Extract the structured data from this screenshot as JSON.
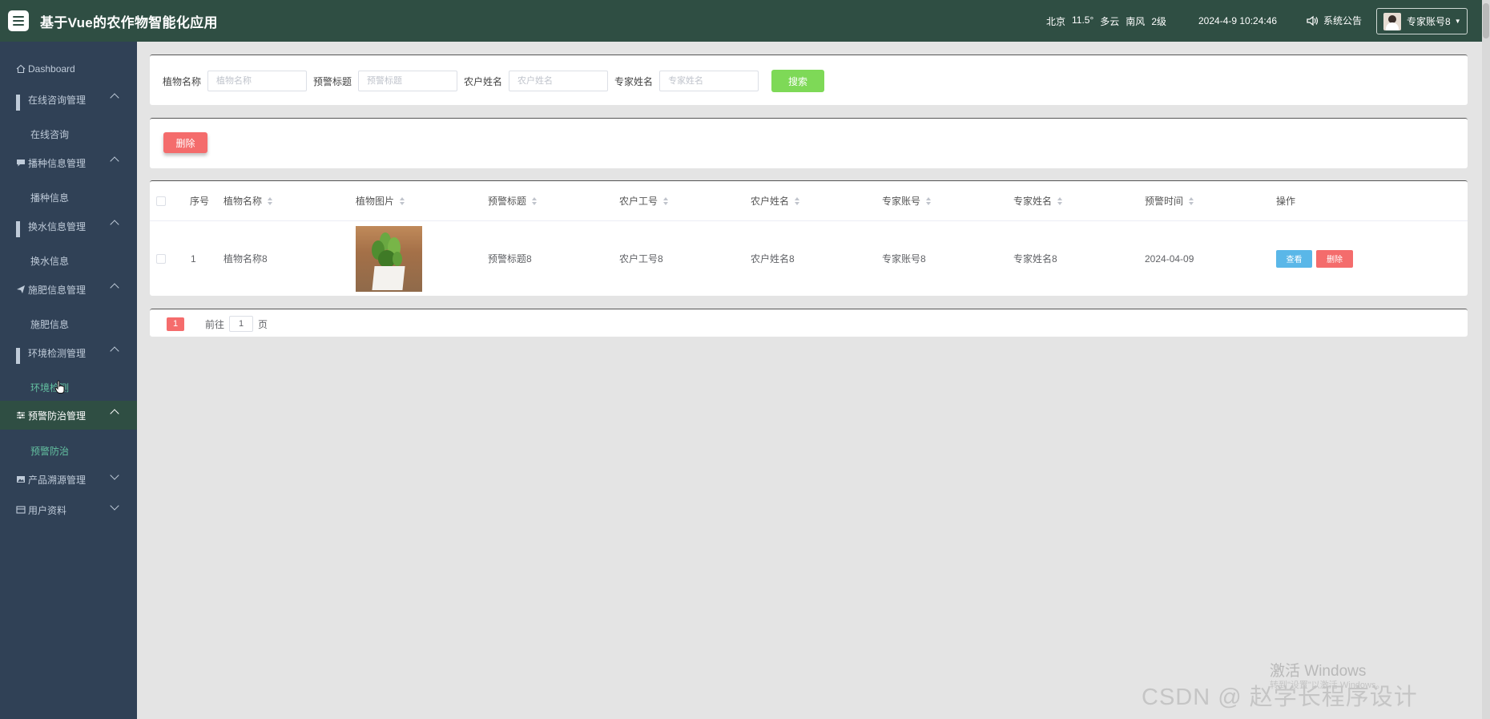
{
  "header": {
    "title": "基于Vue的农作物智能化应用",
    "weather": {
      "city": "北京",
      "temperature": "11.5°",
      "condition": "多云",
      "wind_dir": "南风",
      "wind_level": "2级"
    },
    "datetime": "2024-4-9 10:24:46",
    "notice": "系统公告",
    "user": "专家账号8"
  },
  "sidebar": {
    "dashboard": "Dashboard",
    "groups": [
      {
        "label": "在线咨询管理",
        "icon": "grid-icon",
        "expanded": true,
        "children": [
          "在线咨询"
        ]
      },
      {
        "label": "播种信息管理",
        "icon": "chat-icon",
        "expanded": true,
        "children": [
          "播种信息"
        ]
      },
      {
        "label": "换水信息管理",
        "icon": "grid-icon",
        "expanded": true,
        "children": [
          "换水信息"
        ]
      },
      {
        "label": "施肥信息管理",
        "icon": "send-icon",
        "expanded": true,
        "children": [
          "施肥信息"
        ]
      },
      {
        "label": "环境检测管理",
        "icon": "grid-icon",
        "expanded": true,
        "children": [
          "环境检测"
        ]
      },
      {
        "label": "预警防治管理",
        "icon": "sliders-icon",
        "expanded": true,
        "active": true,
        "children": [
          "预警防治"
        ]
      },
      {
        "label": "产品溯源管理",
        "icon": "image-icon",
        "expanded": false,
        "children": []
      },
      {
        "label": "用户资料",
        "icon": "card-icon",
        "expanded": false,
        "children": []
      }
    ]
  },
  "search": {
    "fields": [
      {
        "label": "植物名称",
        "placeholder": "植物名称"
      },
      {
        "label": "预警标题",
        "placeholder": "预警标题"
      },
      {
        "label": "农户姓名",
        "placeholder": "农户姓名"
      },
      {
        "label": "专家姓名",
        "placeholder": "专家姓名"
      }
    ],
    "button": "搜索"
  },
  "actions": {
    "delete": "删除"
  },
  "table": {
    "headers": [
      "序号",
      "植物名称",
      "植物图片",
      "预警标题",
      "农户工号",
      "农户姓名",
      "专家账号",
      "专家姓名",
      "预警时间",
      "操作"
    ],
    "rows": [
      {
        "index": "1",
        "plant_name": "植物名称8",
        "warning_title": "预警标题8",
        "farmer_id": "农户工号8",
        "farmer_name": "农户姓名8",
        "expert_account": "专家账号8",
        "expert_name": "专家姓名8",
        "time": "2024-04-09",
        "view": "查看",
        "delete": "删除"
      }
    ]
  },
  "pagination": {
    "current": "1",
    "goto_label": "前往",
    "goto_value": "1",
    "page_unit": "页"
  },
  "watermarks": {
    "windows": "激活 Windows",
    "windows_sub": "转到\"设置\"以激活 Windows。",
    "csdn": "CSDN @ 赵学长程序设计"
  },
  "colors": {
    "header_bg": "#2f4e43",
    "sidebar_bg": "#304156",
    "accent_green": "#7ed957",
    "danger": "#f46c6c",
    "info": "#5ab7e8",
    "active_text": "#63c0a0"
  }
}
